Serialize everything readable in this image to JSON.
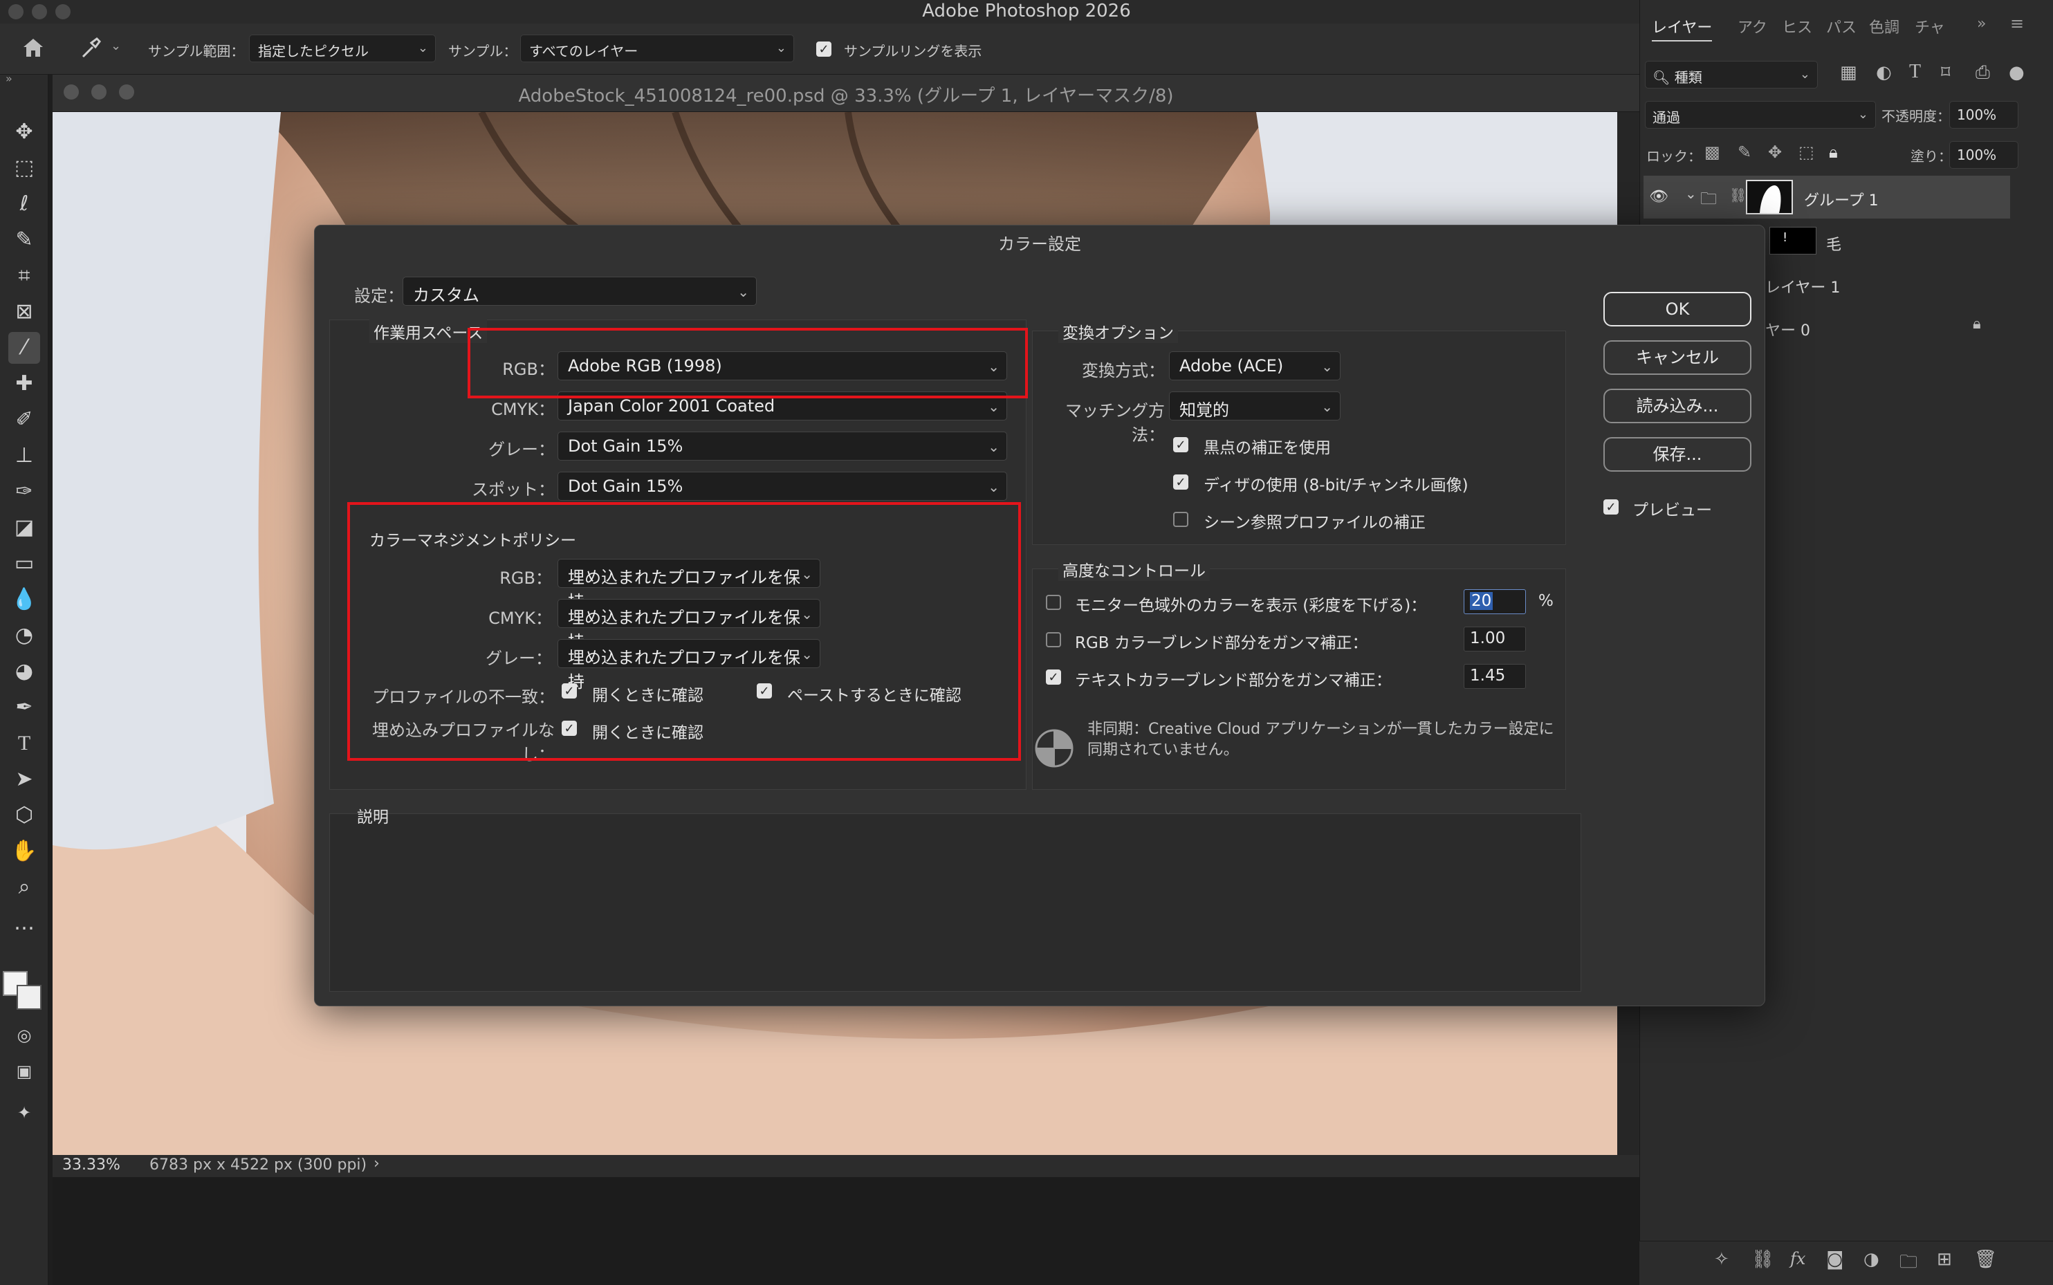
{
  "app": {
    "title": "Adobe Photoshop 2026"
  },
  "options_bar": {
    "sample_size_label": "サンプル範囲：",
    "sample_size_value": "指定したピクセル",
    "sample_label": "サンプル：",
    "sample_value": "すべてのレイヤー",
    "show_ring_label": "サンプルリングを表示",
    "show_ring_checked": true
  },
  "document": {
    "title": "AdobeStock_451008124_re00.psd @ 33.3% (グループ 1, レイヤーマスク/8)",
    "zoom": "33.33%",
    "dimensions": "6783 px x 4522 px (300 ppi)"
  },
  "layers_panel": {
    "tabs": [
      "レイヤー",
      "アク",
      "ヒス",
      "パス",
      "色調",
      "チャ"
    ],
    "active_tab": "レイヤー",
    "filter_label": "種類",
    "blend_mode": "通過",
    "opacity_label": "不透明度：",
    "opacity": "100%",
    "lock_label": "ロック：",
    "fill_label": "塗り：",
    "fill": "100%",
    "layers": [
      {
        "name": "グループ 1",
        "type": "group",
        "visible": true
      },
      {
        "name": "毛",
        "type": "layer"
      },
      {
        "name": "レイヤー 1",
        "type": "layer"
      },
      {
        "name": "ヤー 0",
        "type": "layer",
        "locked": true
      }
    ]
  },
  "dialog": {
    "title": "カラー設定",
    "settings_label": "設定：",
    "settings_value": "カスタム",
    "working_spaces": {
      "heading": "作業用スペース",
      "rgb_label": "RGB：",
      "rgb_value": "Adobe RGB (1998)",
      "cmyk_label": "CMYK：",
      "cmyk_value": "Japan Color 2001 Coated",
      "gray_label": "グレー：",
      "gray_value": "Dot Gain 15%",
      "spot_label": "スポット：",
      "spot_value": "Dot Gain 15%"
    },
    "policies": {
      "heading": "カラーマネジメントポリシー",
      "rgb_label": "RGB：",
      "rgb_value": "埋め込まれたプロファイルを保持",
      "cmyk_label": "CMYK：",
      "cmyk_value": "埋め込まれたプロファイルを保持",
      "gray_label": "グレー：",
      "gray_value": "埋め込まれたプロファイルを保持",
      "mismatch_label": "プロファイルの不一致：",
      "mismatch_open": "開くときに確認",
      "mismatch_open_checked": true,
      "mismatch_paste": "ペーストするときに確認",
      "mismatch_paste_checked": true,
      "missing_label": "埋め込みプロファイルなし：",
      "missing_open": "開くときに確認",
      "missing_open_checked": true
    },
    "conversion": {
      "heading": "変換オプション",
      "engine_label": "変換方式：",
      "engine_value": "Adobe (ACE)",
      "intent_label": "マッチング方法：",
      "intent_value": "知覚的",
      "bpc_label": "黒点の補正を使用",
      "bpc_checked": true,
      "dither_label": "ディザの使用 (8-bit/チャンネル画像)",
      "dither_checked": true,
      "scene_label": "シーン参照プロファイルの補正",
      "scene_checked": false
    },
    "advanced": {
      "heading": "高度なコントロール",
      "desaturate_label": "モニター色域外のカラーを表示 (彩度を下げる)：",
      "desaturate_checked": false,
      "desaturate_value": "20",
      "desaturate_unit": "%",
      "blend_rgb_label": "RGB カラーブレンド部分をガンマ補正：",
      "blend_rgb_checked": false,
      "blend_rgb_value": "1.00",
      "blend_text_label": "テキストカラーブレンド部分をガンマ補正：",
      "blend_text_checked": true,
      "blend_text_value": "1.45"
    },
    "sync_message_line1": "非同期：Creative Cloud アプリケーションが一貫したカラー設定に",
    "sync_message_line2": "同期されていません。",
    "description_heading": "説明",
    "buttons": {
      "ok": "OK",
      "cancel": "キャンセル",
      "load": "読み込み...",
      "save": "保存..."
    },
    "preview_label": "プレビュー",
    "preview_checked": true
  },
  "colors": {
    "highlight": "#e3141b",
    "panel_bg": "#2c2c2c",
    "dialog_bg": "#323232"
  }
}
